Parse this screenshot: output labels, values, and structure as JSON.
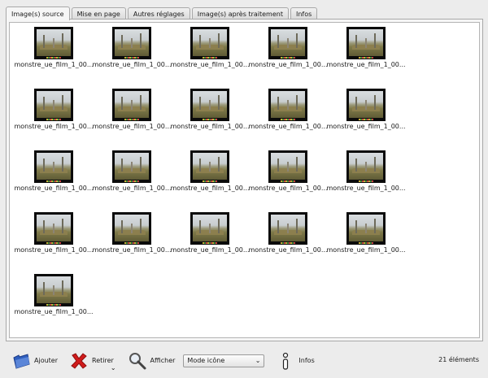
{
  "tabs": [
    {
      "label": "Image(s) source",
      "active": true
    },
    {
      "label": "Mise en page",
      "active": false
    },
    {
      "label": "Autres réglages",
      "active": false
    },
    {
      "label": "Image(s) après traitement",
      "active": false
    },
    {
      "label": "Infos",
      "active": false
    }
  ],
  "images": [
    "monstre_ue_film_1_00...",
    "monstre_ue_film_1_00...",
    "monstre_ue_film_1_00...",
    "monstre_ue_film_1_00...",
    "monstre_ue_film_1_00...",
    "monstre_ue_film_1_00...",
    "monstre_ue_film_1_00...",
    "monstre_ue_film_1_00...",
    "monstre_ue_film_1_00...",
    "monstre_ue_film_1_00...",
    "monstre_ue_film_1_00...",
    "monstre_ue_film_1_00...",
    "monstre_ue_film_1_00...",
    "monstre_ue_film_1_00...",
    "monstre_ue_film_1_00...",
    "monstre_ue_film_1_00...",
    "monstre_ue_film_1_00...",
    "monstre_ue_film_1_00...",
    "monstre_ue_film_1_00...",
    "monstre_ue_film_1_00...",
    "monstre_ue_film_1_00..."
  ],
  "toolbar": {
    "add_label": "Ajouter",
    "remove_label": "Retirer",
    "view_label": "Afficher",
    "mode_selected": "Mode icône",
    "info_label": "Infos",
    "count_label": "21 éléments"
  },
  "icons": {
    "add": "folder-open-icon",
    "remove": "red-x-icon",
    "view": "magnifier-icon",
    "info": "info-icon",
    "dropdown": "chevron-down-icon"
  },
  "colors": {
    "remove_red": "#d11b1b",
    "folder_blue": "#2f5fbf"
  }
}
